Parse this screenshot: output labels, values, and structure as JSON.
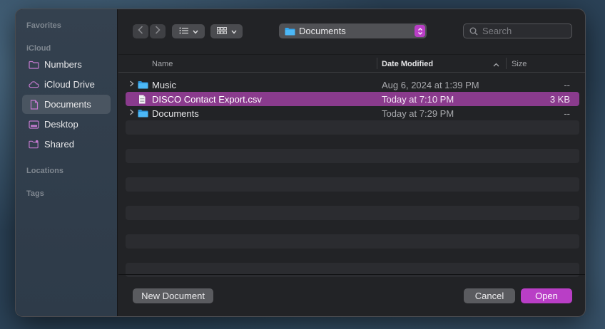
{
  "sidebar": {
    "favorites_header": "Favorites",
    "icloud_header": "iCloud",
    "items": [
      {
        "label": "Numbers",
        "icon": "folder-icon"
      },
      {
        "label": "iCloud Drive",
        "icon": "cloud-icon"
      },
      {
        "label": "Documents",
        "icon": "document-icon",
        "selected": true
      },
      {
        "label": "Desktop",
        "icon": "desktop-icon"
      },
      {
        "label": "Shared",
        "icon": "shared-folder-icon"
      }
    ],
    "locations_header": "Locations",
    "tags_header": "Tags"
  },
  "toolbar": {
    "location": "Documents",
    "search_placeholder": "Search"
  },
  "columns": {
    "name": "Name",
    "date_modified": "Date Modified",
    "size": "Size"
  },
  "files": [
    {
      "name": "Music",
      "date": "Aug 6, 2024 at 1:39 PM",
      "size": "--",
      "kind": "folder"
    },
    {
      "name": "DISCO Contact Export.csv",
      "date": "Today at 7:10 PM",
      "size": "3 KB",
      "kind": "csv",
      "selected": true
    },
    {
      "name": "Documents",
      "date": "Today at 7:29 PM",
      "size": "--",
      "kind": "folder"
    }
  ],
  "buttons": {
    "new_document": "New Document",
    "cancel": "Cancel",
    "open": "Open"
  },
  "colors": {
    "accent": "#b93ec6",
    "selection": "#8a3b8d",
    "folder": "#35a8f0"
  }
}
